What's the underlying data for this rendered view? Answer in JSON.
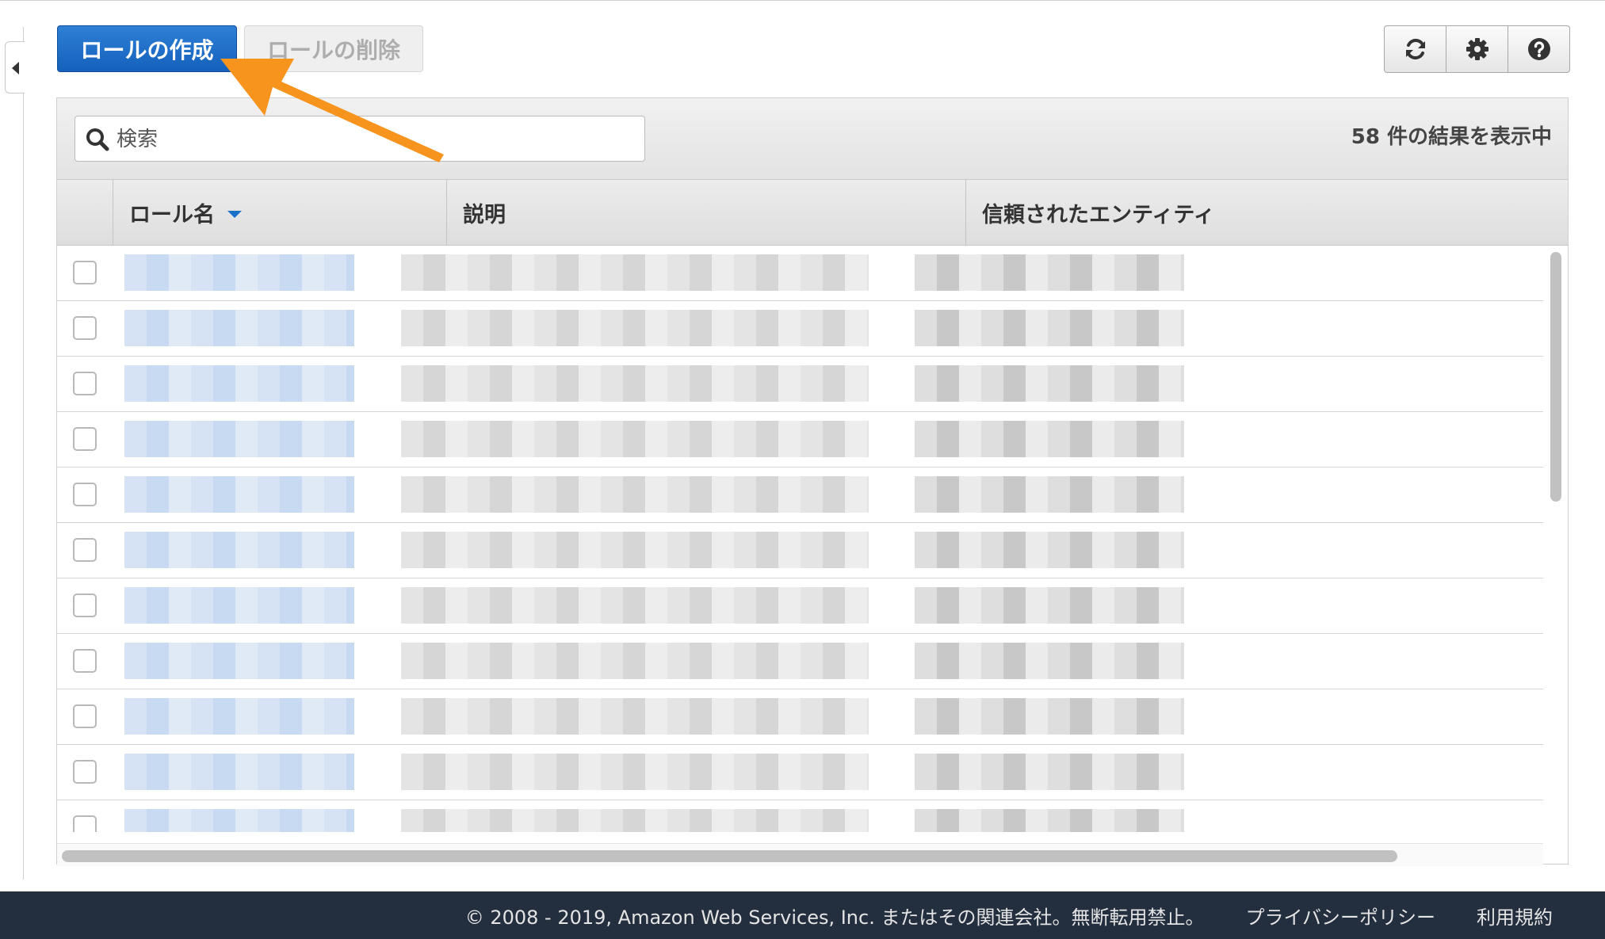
{
  "toolbar": {
    "create_label": "ロールの作成",
    "delete_label": "ロールの削除"
  },
  "icons": {
    "refresh": "refresh-icon",
    "settings": "gear-icon",
    "help": "help-icon",
    "search": "search-icon",
    "collapse": "caret-left-icon"
  },
  "search": {
    "placeholder": "検索",
    "value": ""
  },
  "results": {
    "count_text": "58 件の結果を表示中"
  },
  "table": {
    "columns": [
      "ロール名",
      "説明",
      "信頼されたエンティティ"
    ],
    "sorted_by": "ロール名",
    "sort_direction": "descending",
    "row_count_visible": 11
  },
  "footer": {
    "copyright": "© 2008 - 2019, Amazon Web Services, Inc. またはその関連会社。無断転用禁止。",
    "privacy": "プライバシーポリシー",
    "terms": "利用規約"
  },
  "colors": {
    "primary_button": "#1a6fc9",
    "footer_bg": "#232f3e",
    "annotation_arrow": "#f7941d"
  }
}
